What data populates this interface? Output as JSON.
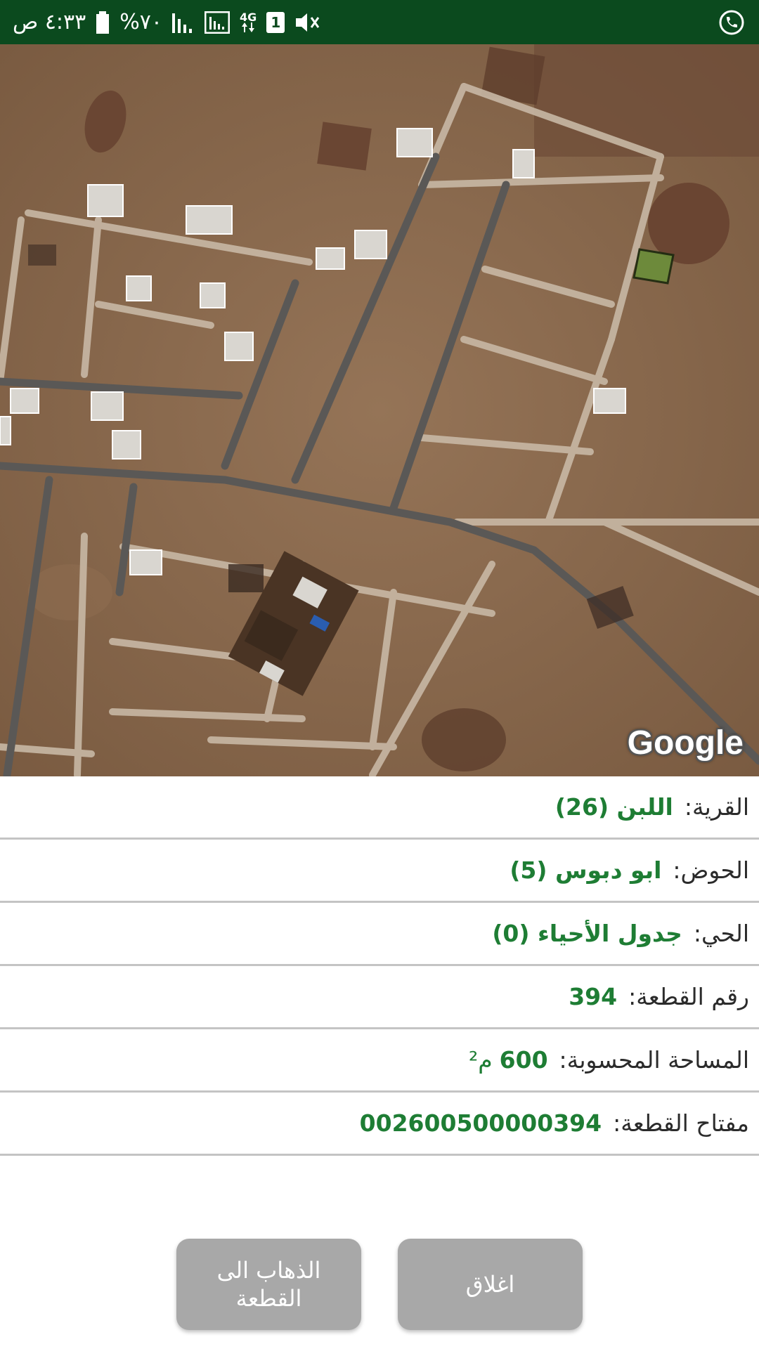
{
  "status_bar": {
    "time": "٤:٣٣ ص",
    "battery": "%٧٠",
    "network": "4G",
    "sim_slot": "1",
    "icons": [
      "battery-icon",
      "signal-icon",
      "signal-box-icon",
      "network-4g-icon",
      "sim-1-icon",
      "mute-icon",
      "call-icon"
    ]
  },
  "map": {
    "attribution": "Google"
  },
  "parcel": {
    "rows": [
      {
        "label": "القرية:",
        "value": "اللبن (26)"
      },
      {
        "label": "الحوض:",
        "value": "ابو دبوس (5)"
      },
      {
        "label": "الحي:",
        "value": "جدول الأحياء (0)"
      },
      {
        "label": "رقم القطعة:",
        "value": "394"
      },
      {
        "label": "المساحة المحسوبة:",
        "value": "600",
        "unit": "م²"
      },
      {
        "label": "مفتاح القطعة:",
        "value": "002600500000394"
      }
    ]
  },
  "buttons": {
    "go_to_parcel": "الذهاب الى القطعة",
    "close": "اغلاق"
  },
  "colors": {
    "status_bar": "#0b4a1e",
    "value_green": "#1e7d34",
    "button_gray": "#a8a8a8",
    "highlight_parcel": "#6b8f3a"
  }
}
